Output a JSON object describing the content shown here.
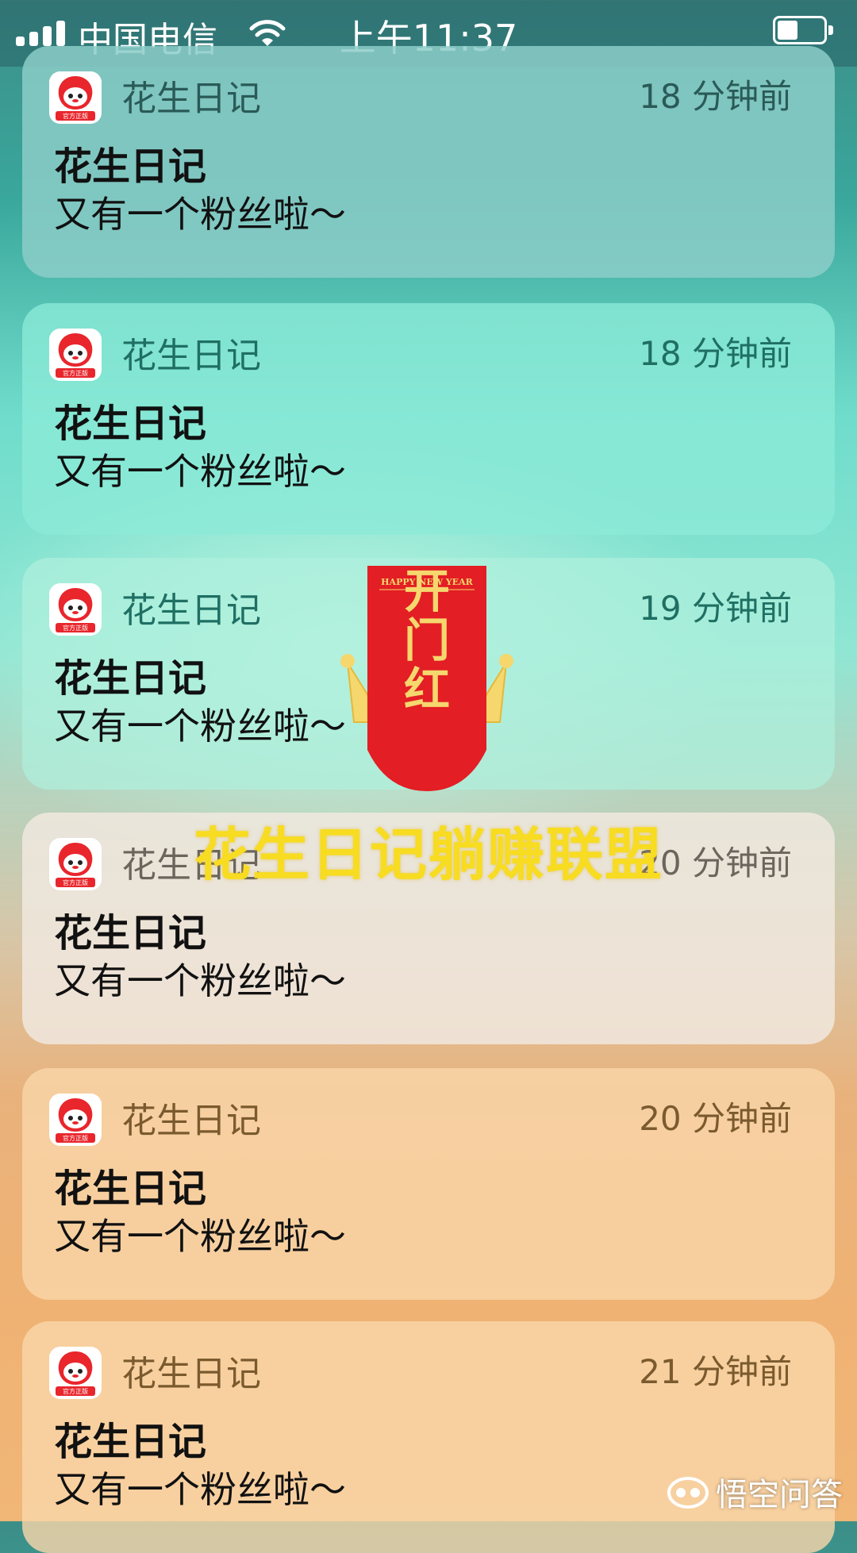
{
  "status_bar": {
    "carrier": "中国电信",
    "time": "上午11:37",
    "signal_bars": 4,
    "battery_level": 0.45,
    "icons": [
      "signal-icon",
      "wifi-icon",
      "battery-icon"
    ]
  },
  "notifications": [
    {
      "app": "花生日记",
      "time": "18 分钟前",
      "title": "花生日记",
      "body": "又有一个粉丝啦～"
    },
    {
      "app": "花生日记",
      "time": "18 分钟前",
      "title": "花生日记",
      "body": "又有一个粉丝啦～"
    },
    {
      "app": "花生日记",
      "time": "19 分钟前",
      "title": "花生日记",
      "body": "又有一个粉丝啦～"
    },
    {
      "app": "花生日记",
      "time": "20 分钟前",
      "title": "花生日记",
      "body": "又有一个粉丝啦～"
    },
    {
      "app": "花生日记",
      "time": "20 分钟前",
      "title": "花生日记",
      "body": "又有一个粉丝啦～"
    },
    {
      "app": "花生日记",
      "time": "21 分钟前",
      "title": "花生日记",
      "body": "又有一个粉丝啦～"
    }
  ],
  "app_icon_badge": "官方正版",
  "overlay": {
    "banner_top_text": "HAPPY NEW YEAR",
    "banner_text": "开门红",
    "caption": "花生日记躺赚联盟"
  },
  "watermark": {
    "text": "悟空问答",
    "icon": "wukong-logo-icon"
  },
  "colors": {
    "app_icon_red": "#e8262c",
    "banner_red": "#e31e24",
    "banner_gold": "#f5d76e",
    "caption_yellow": "#f7dc21"
  }
}
